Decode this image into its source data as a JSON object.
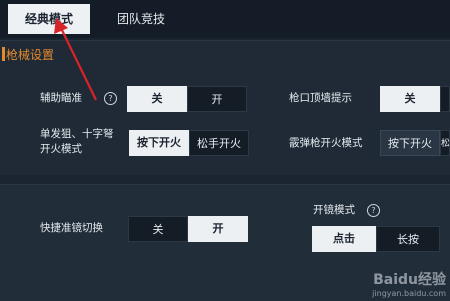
{
  "tabs": [
    {
      "label": "经典模式",
      "active": true
    },
    {
      "label": "团队竞技",
      "active": false
    }
  ],
  "section1": {
    "title": "枪械设置",
    "aim_assist": {
      "label": "辅助瞄准",
      "help": "?",
      "off": "关",
      "on": "开",
      "selected": "off"
    },
    "muzzle_hint": {
      "label": "枪口顶墙提示",
      "off": "关",
      "on": "开",
      "selected": "off"
    },
    "single_fire": {
      "label_line1": "单发狙、十字弩",
      "label_line2": "开火模式",
      "option1": "按下开火",
      "option2": "松手开火",
      "selected": "option1"
    },
    "shotgun": {
      "label": "霰弹枪开火模式",
      "option1": "按下开火",
      "option2": "松"
    }
  },
  "section2": {
    "scope_switch": {
      "label": "快捷准镜切换",
      "off": "关",
      "on": "开",
      "selected": "on"
    },
    "scope_mode": {
      "label": "开镜模式",
      "help": "?",
      "option1": "点击",
      "option2": "长按",
      "selected": "option1"
    }
  },
  "watermark": {
    "line1": "Baidu经验",
    "line2": "jingyan.baidu.com"
  },
  "colors": {
    "accent": "#e48a2b",
    "arrow": "#d8232a",
    "background": "#1b2531"
  }
}
